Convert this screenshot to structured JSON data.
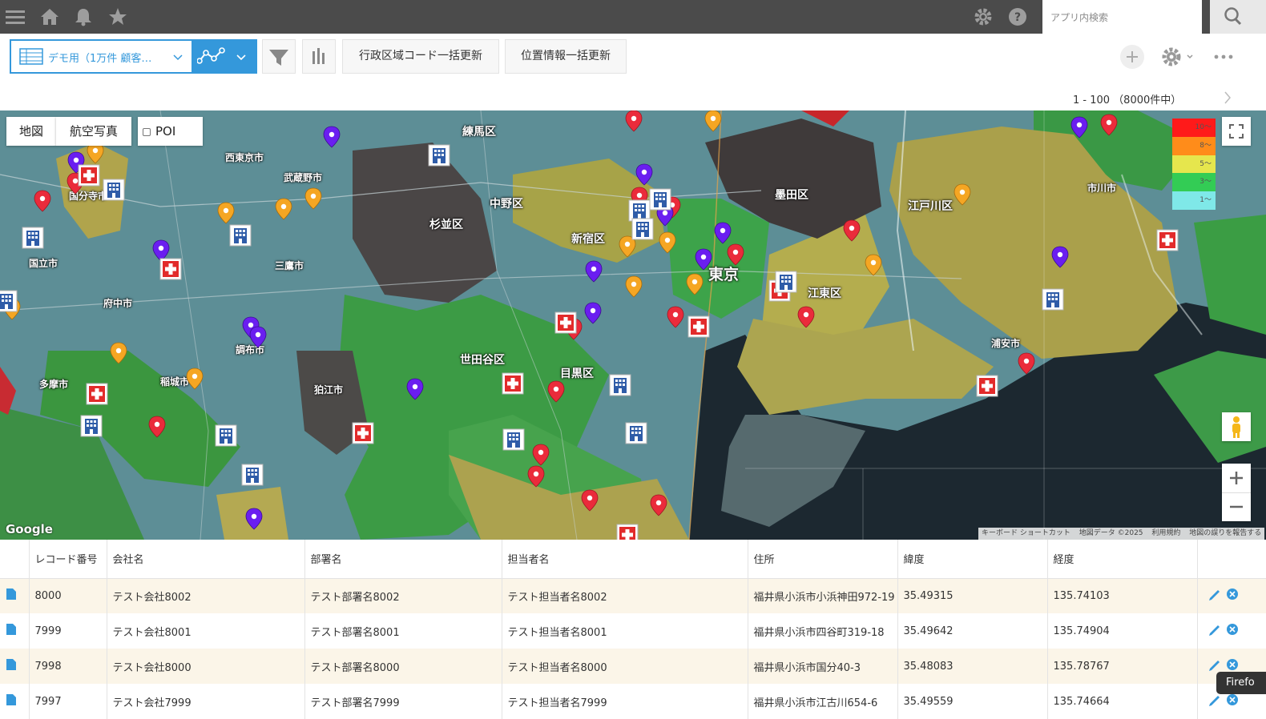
{
  "topbar": {
    "search_placeholder": "アプリ内検索"
  },
  "toolbar": {
    "view_label": "デモ用（1万件 顧客…",
    "bulk_admin_code_button": "行政区域コード一括更新",
    "bulk_location_button": "位置情報一括更新",
    "pager_text": "1 - 100 （8000件中）"
  },
  "map": {
    "type_map": "地図",
    "type_satellite": "航空写真",
    "poi_label": "POI",
    "poi_checked": false,
    "legend": [
      {
        "label": "10～",
        "color": "#ff1a1a"
      },
      {
        "label": "8～",
        "color": "#ff8c1a"
      },
      {
        "label": "5～",
        "color": "#e6e64d"
      },
      {
        "label": "3～",
        "color": "#33cc55"
      },
      {
        "label": "1～",
        "color": "#7fe8e8"
      }
    ],
    "place_labels": [
      "練馬区",
      "中野区",
      "杉並区",
      "新宿区",
      "墨田区",
      "江戸川区",
      "江東区",
      "世田谷区",
      "目黒区",
      "狛江市",
      "西東京市",
      "武蔵野市",
      "三鷹市",
      "府中市",
      "調布市",
      "多摩市",
      "稲城市",
      "国分寺市",
      "国立市",
      "市川市",
      "浦安市",
      "東京"
    ],
    "google_logo": "Google",
    "attribution": [
      "キーボード ショートカット",
      "地図データ ©2025",
      "利用規約",
      "地図の誤りを報告する"
    ]
  },
  "table": {
    "headers": [
      "レコード番号",
      "会社名",
      "部署名",
      "担当者名",
      "住所",
      "緯度",
      "経度"
    ],
    "rows": [
      {
        "id": "8000",
        "company": "テスト会社8002",
        "dept": "テスト部署名8002",
        "person": "テスト担当者名8002",
        "address": "福井県小浜市小浜神田972-19",
        "lat": "35.49315",
        "lng": "135.74103"
      },
      {
        "id": "7999",
        "company": "テスト会社8001",
        "dept": "テスト部署名8001",
        "person": "テスト担当者名8001",
        "address": "福井県小浜市四谷町319-18",
        "lat": "35.49642",
        "lng": "135.74904"
      },
      {
        "id": "7998",
        "company": "テスト会社8000",
        "dept": "テスト部署名8000",
        "person": "テスト担当者名8000",
        "address": "福井県小浜市国分40-3",
        "lat": "35.48083",
        "lng": "135.78767"
      },
      {
        "id": "7997",
        "company": "テスト会社7999",
        "dept": "テスト部署名7999",
        "person": "テスト担当者名7999",
        "address": "福井県小浜市江古川654-6",
        "lat": "35.49559",
        "lng": "135.74664"
      }
    ]
  },
  "firefox_badge": "Firefo"
}
